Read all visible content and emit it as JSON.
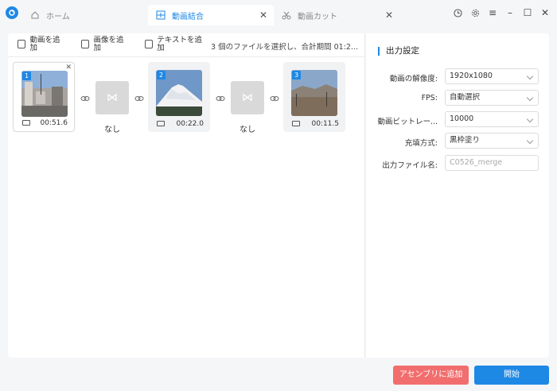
{
  "tabs": {
    "home": "ホーム",
    "merge": "動画結合",
    "cut": "動画カット"
  },
  "toolbar": {
    "add_video": "動画を追加",
    "add_image": "画像を追加",
    "add_text": "テキストを追加",
    "status": "3 個のファイルを選択し、合計期間 01:2..."
  },
  "clips": [
    {
      "index": "1",
      "duration": "00:51.6"
    },
    {
      "index": "2",
      "duration": "00:22.0"
    },
    {
      "index": "3",
      "duration": "00:11.5"
    }
  ],
  "transitions": [
    {
      "label": "なし"
    },
    {
      "label": "なし"
    }
  ],
  "settings": {
    "title": "出力設定",
    "resolution_label": "動画の解像度:",
    "resolution_value": "1920x1080",
    "fps_label": "FPS:",
    "fps_value": "自動選択",
    "bitrate_label": "動画ビットレー...",
    "bitrate_value": "10000",
    "fill_label": "充填方式:",
    "fill_value": "黒枠塗り",
    "filename_label": "出力ファイル名:",
    "filename_placeholder": "C0526_merge"
  },
  "buttons": {
    "add_assembly": "アセンブリに追加",
    "start": "開始"
  },
  "colors": {
    "accent": "#1e88e5",
    "danger": "#f26e6e"
  }
}
